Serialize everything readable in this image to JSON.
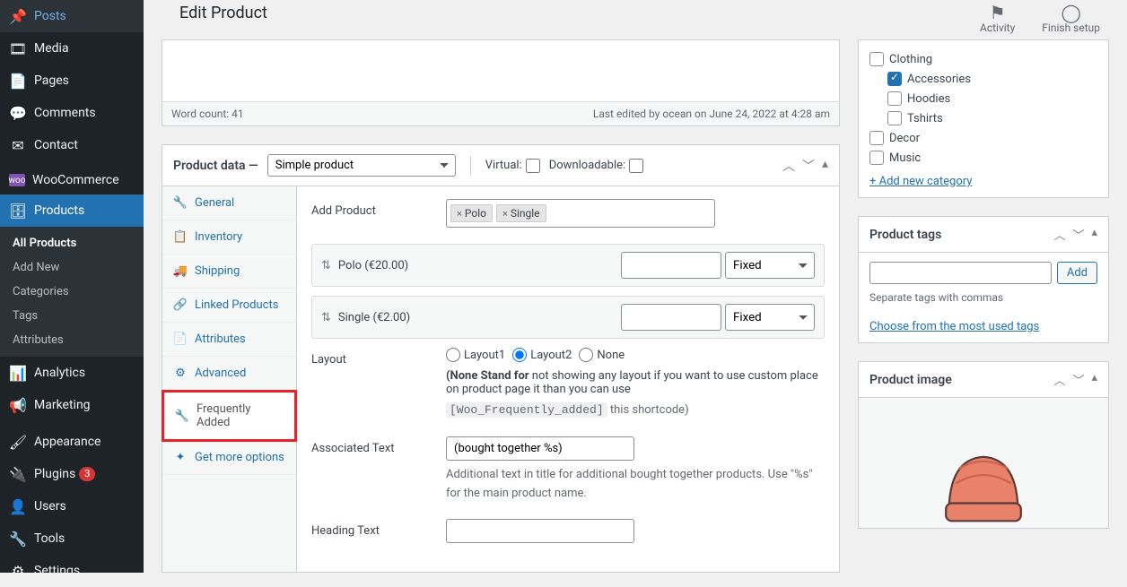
{
  "page_title": "Edit Product",
  "top_actions": {
    "activity": "Activity",
    "finish": "Finish setup"
  },
  "sidebar": {
    "items": [
      {
        "label": "Posts",
        "icon": "📌"
      },
      {
        "label": "Media",
        "icon": "🎞"
      },
      {
        "label": "Pages",
        "icon": "📄"
      },
      {
        "label": "Comments",
        "icon": "💬"
      },
      {
        "label": "Contact",
        "icon": "✉"
      },
      {
        "label": "WooCommerce",
        "icon": "ⓦ"
      },
      {
        "label": "Products",
        "icon": "🗄",
        "active": true
      },
      {
        "label": "Analytics",
        "icon": "📊"
      },
      {
        "label": "Marketing",
        "icon": "📢"
      },
      {
        "label": "Appearance",
        "icon": "🖌"
      },
      {
        "label": "Plugins",
        "icon": "🔌",
        "badge": "3"
      },
      {
        "label": "Users",
        "icon": "👤"
      },
      {
        "label": "Tools",
        "icon": "🔧"
      },
      {
        "label": "Settings",
        "icon": "⚙"
      }
    ],
    "submenu": [
      {
        "label": "All Products",
        "current": true
      },
      {
        "label": "Add New"
      },
      {
        "label": "Categories"
      },
      {
        "label": "Tags"
      },
      {
        "label": "Attributes"
      }
    ]
  },
  "editor_footer": {
    "wordcount": "Word count: 41",
    "last_edited": "Last edited by ocean on June 24, 2022 at 4:28 am"
  },
  "product_data": {
    "heading": "Product data —",
    "type_options": [
      "Simple product"
    ],
    "virtual_label": "Virtual:",
    "downloadable_label": "Downloadable:",
    "tabs": [
      "General",
      "Inventory",
      "Shipping",
      "Linked Products",
      "Attributes",
      "Advanced",
      "Frequently Added",
      "Get more options"
    ],
    "addproduct": {
      "label": "Add Product",
      "tokens": [
        "Polo",
        "Single"
      ]
    },
    "rows": [
      {
        "label": "Polo (€20.00)",
        "type": "Fixed"
      },
      {
        "label": "Single (€2.00)",
        "type": "Fixed"
      }
    ],
    "layout": {
      "label": "Layout",
      "options": [
        "Layout1",
        "Layout2",
        "None"
      ],
      "note_bold": "(None Stand for",
      "note_rest": " not showing any layout if you want to use custom place on product page it than you can use ",
      "shortcode": "[Woo_Frequently_added]",
      "note_tail": " this shortcode)"
    },
    "assoc": {
      "label": "Associated Text",
      "value": "(bought together %s)",
      "desc": "Additional text in title for additional bought together products. Use \"%s\" for the main product name."
    },
    "heading_text_label": "Heading Text"
  },
  "categories": {
    "items": [
      {
        "label": "Clothing",
        "checked": false,
        "indent": false
      },
      {
        "label": "Accessories",
        "checked": true,
        "indent": true
      },
      {
        "label": "Hoodies",
        "checked": false,
        "indent": true
      },
      {
        "label": "Tshirts",
        "checked": false,
        "indent": true
      },
      {
        "label": "Decor",
        "checked": false,
        "indent": false
      },
      {
        "label": "Music",
        "checked": false,
        "indent": false
      }
    ],
    "add_link": "+ Add new category"
  },
  "tags": {
    "title": "Product tags",
    "add": "Add",
    "hint": "Separate tags with commas",
    "choose": "Choose from the most used tags"
  },
  "image": {
    "title": "Product image"
  }
}
